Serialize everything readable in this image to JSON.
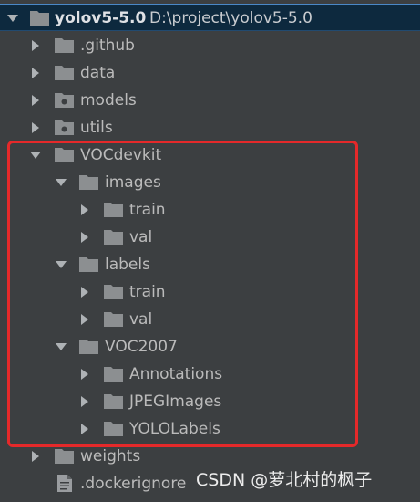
{
  "project_tree": {
    "root": {
      "name": "yolov5-5.0",
      "path": "D:\\project\\yolov5-5.0",
      "expanded": true,
      "selected": true
    },
    "items": [
      {
        "label": ".github",
        "expanded": false
      },
      {
        "label": "data",
        "expanded": false
      },
      {
        "label": "models",
        "expanded": false
      },
      {
        "label": "utils",
        "expanded": false
      },
      {
        "label": "VOCdevkit",
        "expanded": true
      },
      {
        "label": "images",
        "expanded": true
      },
      {
        "label": "train",
        "expanded": false
      },
      {
        "label": "val",
        "expanded": false
      },
      {
        "label": "labels",
        "expanded": true
      },
      {
        "label": "train",
        "expanded": false
      },
      {
        "label": "val",
        "expanded": false
      },
      {
        "label": "VOC2007",
        "expanded": true
      },
      {
        "label": "Annotations",
        "expanded": false
      },
      {
        "label": "JPEGImages",
        "expanded": false
      },
      {
        "label": "YOLOLabels",
        "expanded": false
      },
      {
        "label": "weights",
        "expanded": false
      },
      {
        "label": ".dockerignore",
        "type": "file"
      }
    ]
  },
  "annotation": {
    "highlight_color": "#e5292a"
  },
  "watermark": {
    "text": "CSDN @萝北村的枫子"
  },
  "colors": {
    "background": "#3c3f41",
    "selection": "#0d293e",
    "text": "#bbbbbb",
    "folder": "#8c8f91",
    "arrow": "#aeb2b5"
  }
}
